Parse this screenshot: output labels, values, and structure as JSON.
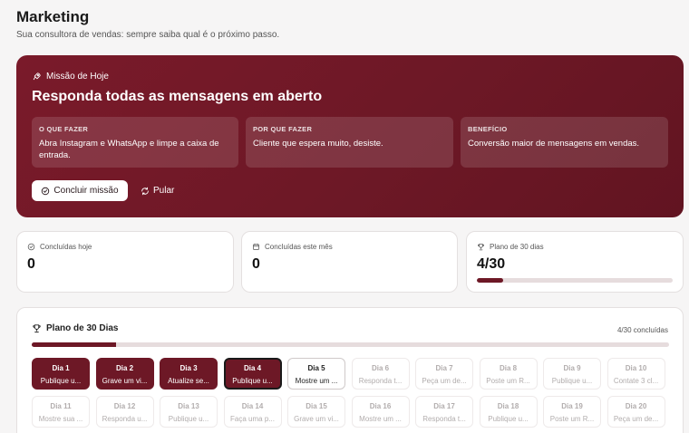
{
  "header": {
    "title": "Marketing",
    "subtitle": "Sua consultora de vendas: sempre saiba qual é o próximo passo."
  },
  "mission": {
    "eyebrow": "Missão de Hoje",
    "title": "Responda todas as mensagens em aberto",
    "what_label": "O QUE FAZER",
    "what_text": "Abra Instagram e WhatsApp e limpe a caixa de entrada.",
    "why_label": "POR QUE FAZER",
    "why_text": "Cliente que espera muito, desiste.",
    "benefit_label": "BENEFÍCIO",
    "benefit_text": "Conversão maior de mensagens em vendas.",
    "complete_label": "Concluir missão",
    "skip_label": "Pular"
  },
  "stats": {
    "today_label": "Concluídas hoje",
    "today_value": "0",
    "month_label": "Concluídas este mês",
    "month_value": "0",
    "plan_label": "Plano de 30 dias",
    "plan_value": "4/30",
    "plan_progress": 0.133
  },
  "plan": {
    "title": "Plano de 30 Dias",
    "count": "4/30 concluídas",
    "progress": 0.133,
    "days": [
      {
        "day": "Dia 1",
        "task": "Publique u...",
        "state": "done"
      },
      {
        "day": "Dia 2",
        "task": "Grave um vi...",
        "state": "done"
      },
      {
        "day": "Dia 3",
        "task": "Atualize se...",
        "state": "done"
      },
      {
        "day": "Dia 4",
        "task": "Publique u...",
        "state": "current"
      },
      {
        "day": "Dia 5",
        "task": "Mostre um ...",
        "state": "next"
      },
      {
        "day": "Dia 6",
        "task": "Responda t...",
        "state": "locked"
      },
      {
        "day": "Dia 7",
        "task": "Peça um de...",
        "state": "locked"
      },
      {
        "day": "Dia 8",
        "task": "Poste um R...",
        "state": "locked"
      },
      {
        "day": "Dia 9",
        "task": "Publique u...",
        "state": "locked"
      },
      {
        "day": "Dia 10",
        "task": "Contate 3 cl...",
        "state": "locked"
      },
      {
        "day": "Dia 11",
        "task": "Mostre sua ...",
        "state": "locked"
      },
      {
        "day": "Dia 12",
        "task": "Responda u...",
        "state": "locked"
      },
      {
        "day": "Dia 13",
        "task": "Publique u...",
        "state": "locked"
      },
      {
        "day": "Dia 14",
        "task": "Faça uma p...",
        "state": "locked"
      },
      {
        "day": "Dia 15",
        "task": "Grave um vi...",
        "state": "locked"
      },
      {
        "day": "Dia 16",
        "task": "Mostre um ...",
        "state": "locked"
      },
      {
        "day": "Dia 17",
        "task": "Responda t...",
        "state": "locked"
      },
      {
        "day": "Dia 18",
        "task": "Publique u...",
        "state": "locked"
      },
      {
        "day": "Dia 19",
        "task": "Poste um R...",
        "state": "locked"
      },
      {
        "day": "Dia 20",
        "task": "Peça um de...",
        "state": "locked"
      }
    ]
  },
  "icons": {
    "mission": "rocket-icon",
    "complete": "check-circle-icon",
    "skip": "refresh-icon",
    "today": "check-circle-icon",
    "month": "calendar-icon",
    "plan": "trophy-icon"
  },
  "colors": {
    "accent": "#6d1826",
    "track": "#e6dcdd"
  }
}
